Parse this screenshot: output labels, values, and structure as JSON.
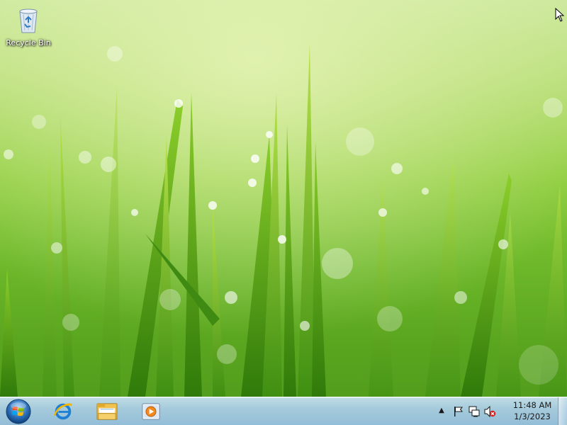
{
  "desktop": {
    "wallpaper": "green-grass-dew",
    "icons": [
      {
        "label": "Recycle Bin",
        "icon": "recycle-bin-icon"
      }
    ]
  },
  "taskbar": {
    "start": {
      "icon": "windows-start-orb-icon"
    },
    "pinned": [
      {
        "icon": "internet-explorer-icon"
      },
      {
        "icon": "file-explorer-icon"
      },
      {
        "icon": "media-player-icon"
      }
    ],
    "tray": {
      "show_hidden_icon": "chevron-up-icon",
      "icons": [
        "action-center-flag-icon",
        "network-icon",
        "volume-muted-icon"
      ],
      "clock": {
        "time": "11:48 AM",
        "date": "1/3/2023"
      }
    }
  },
  "colors": {
    "taskbar_top": "#c8e1f5",
    "taskbar_bottom": "#96bee1",
    "accent_green": "#8ccc3a"
  }
}
